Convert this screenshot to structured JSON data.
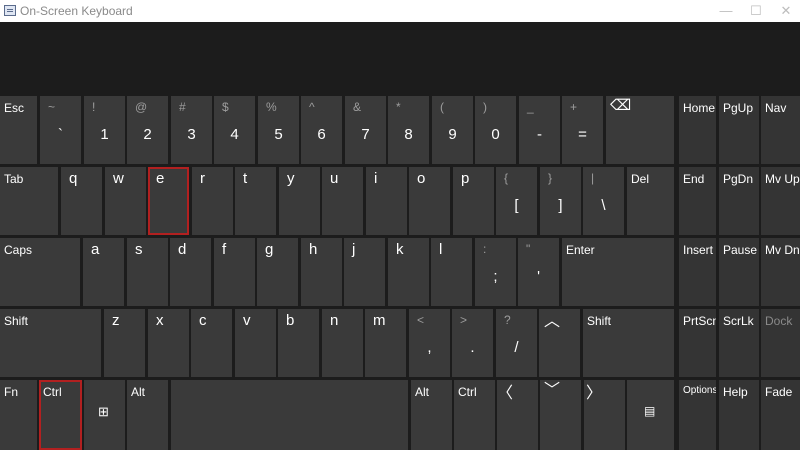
{
  "window": {
    "title": "On-Screen Keyboard",
    "minimize_glyph": "—",
    "maximize_glyph": "☐",
    "close_glyph": "✕"
  },
  "keys": {
    "esc": "Esc",
    "num": [
      {
        "shift": "~",
        "main": "`"
      },
      {
        "shift": "!",
        "main": "1"
      },
      {
        "shift": "@",
        "main": "2"
      },
      {
        "shift": "#",
        "main": "3"
      },
      {
        "shift": "$",
        "main": "4"
      },
      {
        "shift": "%",
        "main": "5"
      },
      {
        "shift": "^",
        "main": "6"
      },
      {
        "shift": "&",
        "main": "7"
      },
      {
        "shift": "*",
        "main": "8"
      },
      {
        "shift": "(",
        "main": "9"
      },
      {
        "shift": ")",
        "main": "0"
      },
      {
        "shift": "_",
        "main": "-"
      },
      {
        "shift": "+",
        "main": "="
      }
    ],
    "backspace_glyph": "⌫",
    "tab": "Tab",
    "row_q": [
      "q",
      "w",
      "e",
      "r",
      "t",
      "y",
      "u",
      "i",
      "o",
      "p"
    ],
    "brackets": [
      {
        "shift": "{",
        "main": "["
      },
      {
        "shift": "}",
        "main": "]"
      },
      {
        "shift": "|",
        "main": "\\"
      }
    ],
    "del": "Del",
    "caps": "Caps",
    "row_a": [
      "a",
      "s",
      "d",
      "f",
      "g",
      "h",
      "j",
      "k",
      "l"
    ],
    "semi": {
      "shift": ":",
      "main": ";"
    },
    "quote": {
      "shift": "\"",
      "main": "'"
    },
    "enter": "Enter",
    "shift_left": "Shift",
    "row_z": [
      "z",
      "x",
      "c",
      "v",
      "b",
      "n",
      "m"
    ],
    "punct": [
      {
        "shift": "<",
        "main": ","
      },
      {
        "shift": ">",
        "main": "."
      },
      {
        "shift": "?",
        "main": "/"
      }
    ],
    "up_glyph": "︿",
    "shift_right": "Shift",
    "fn": "Fn",
    "ctrl_left": "Ctrl",
    "win_glyph": "⊞",
    "alt_left": "Alt",
    "alt_right": "Alt",
    "ctrl_right": "Ctrl",
    "left_glyph": "〈",
    "down_glyph": "﹀",
    "right_glyph": "〉",
    "menu_glyph": "▤"
  },
  "nav": {
    "home": "Home",
    "pgup": "PgUp",
    "nav": "Nav",
    "end": "End",
    "pgdn": "PgDn",
    "mvup": "Mv Up",
    "insert": "Insert",
    "pause": "Pause",
    "mvdn": "Mv Dn",
    "prtscn": "PrtScn",
    "scrlk": "ScrLk",
    "dock": "Dock",
    "options": "Options",
    "help": "Help",
    "fade": "Fade"
  }
}
